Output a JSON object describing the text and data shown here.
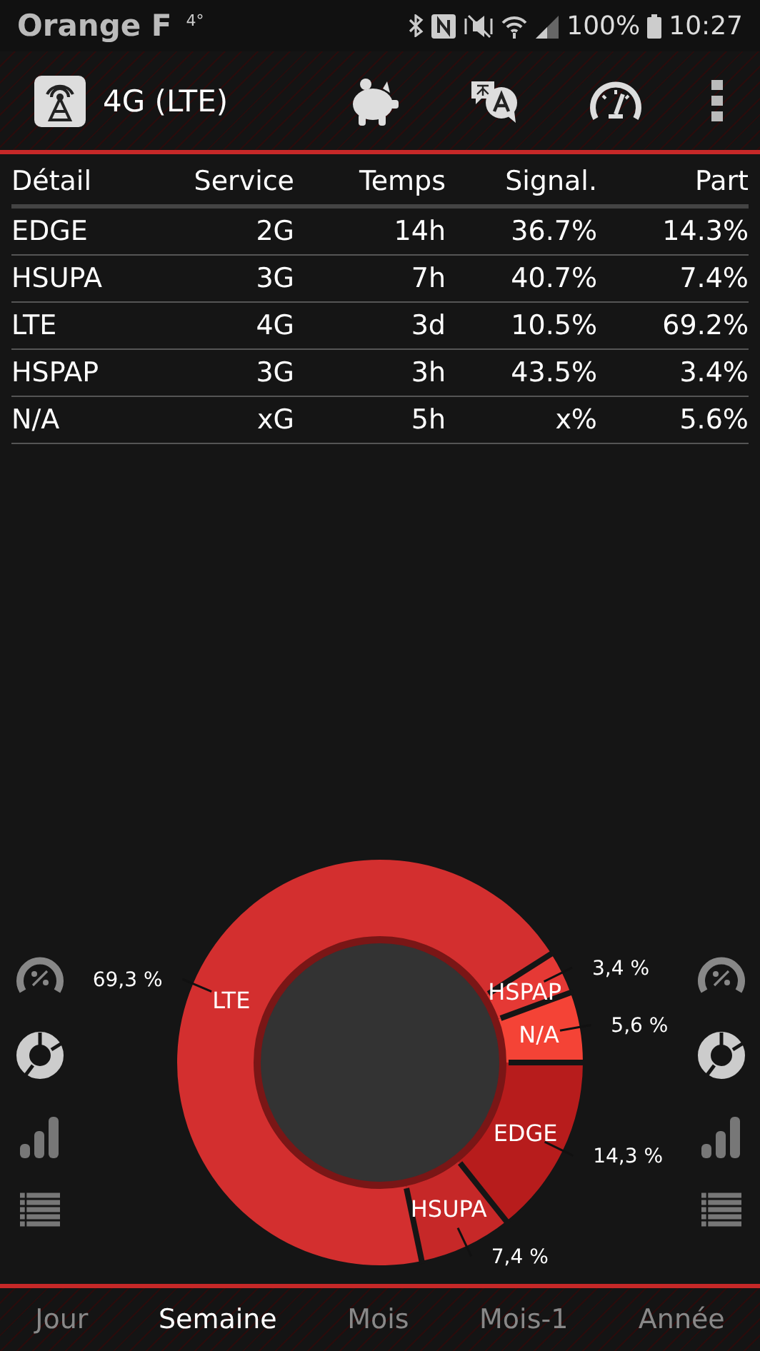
{
  "status_bar": {
    "carrier": "Orange F",
    "temperature": "4°",
    "battery": "100%",
    "time": "10:27"
  },
  "toolbar": {
    "title": "4G (LTE)"
  },
  "table": {
    "columns": [
      "Détail",
      "Service",
      "Temps",
      "Signal.",
      "Part"
    ],
    "rows": [
      [
        "EDGE",
        "2G",
        "14h",
        "36.7%",
        "14.3%"
      ],
      [
        "HSUPA",
        "3G",
        "7h",
        "40.7%",
        "7.4%"
      ],
      [
        "LTE",
        "4G",
        "3d",
        "10.5%",
        "69.2%"
      ],
      [
        "HSPAP",
        "3G",
        "3h",
        "43.5%",
        "3.4%"
      ],
      [
        "N/A",
        "xG",
        "5h",
        "x%",
        "5.6%"
      ]
    ]
  },
  "chart": {
    "chart_data": {
      "type": "donut",
      "categories": [
        "EDGE",
        "HSUPA",
        "LTE",
        "HSPAP",
        "N/A"
      ],
      "values": [
        14.3,
        7.4,
        69.3,
        3.4,
        5.6
      ],
      "colors": [
        "#b71c1c",
        "#c62828",
        "#d32f2f",
        "#e53935",
        "#f44336"
      ],
      "data_labels": true,
      "value_labels": [
        "14,3 %",
        "7,4 %",
        "69,3 %",
        "3,4 %",
        "5,6 %"
      ]
    }
  },
  "tabs": [
    {
      "label": "Jour",
      "selected": false
    },
    {
      "label": "Semaine",
      "selected": true
    },
    {
      "label": "Mois",
      "selected": false
    },
    {
      "label": "Mois-1",
      "selected": false
    },
    {
      "label": "Année",
      "selected": false
    }
  ]
}
